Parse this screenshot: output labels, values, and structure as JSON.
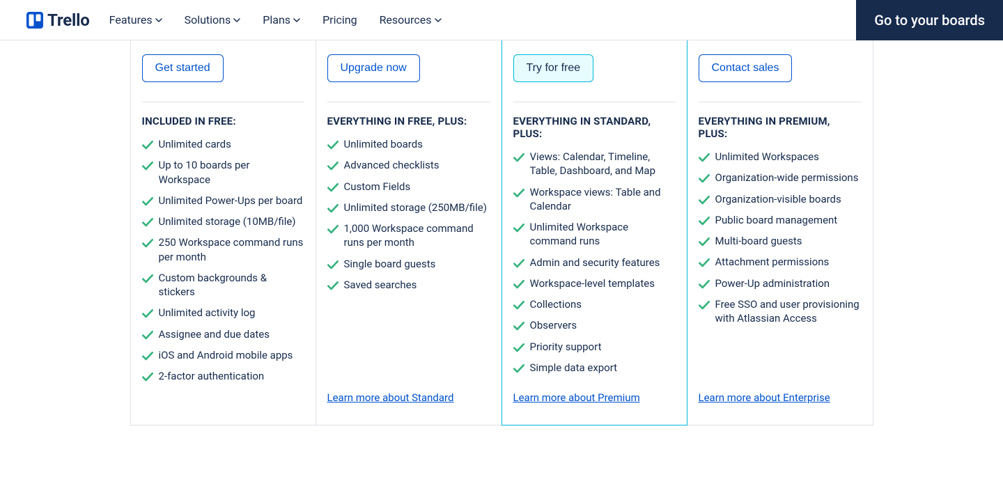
{
  "nav": {
    "brand": "Trello",
    "items": [
      "Features",
      "Solutions",
      "Plans",
      "Pricing",
      "Resources"
    ],
    "items_dropdown": [
      true,
      true,
      true,
      false,
      true
    ],
    "cta": "Go to your boards"
  },
  "columns": [
    {
      "id": "free",
      "cta": "Get started",
      "heading": "INCLUDED IN FREE:",
      "features": [
        "Unlimited cards",
        "Up to 10 boards per Workspace",
        "Unlimited Power-Ups per board",
        "Unlimited storage (10MB/file)",
        "250 Workspace command runs per month",
        "Custom backgrounds & stickers",
        "Unlimited activity log",
        "Assignee and due dates",
        "iOS and Android mobile apps",
        "2-factor authentication"
      ],
      "learn": ""
    },
    {
      "id": "standard",
      "cta": "Upgrade now",
      "heading": "EVERYTHING IN FREE, PLUS:",
      "features": [
        "Unlimited boards",
        "Advanced checklists",
        "Custom Fields",
        "Unlimited storage (250MB/file)",
        "1,000 Workspace command runs per month",
        "Single board guests",
        "Saved searches"
      ],
      "learn": "Learn more about Standard"
    },
    {
      "id": "premium",
      "cta": "Try for free",
      "heading": "EVERYTHING IN STANDARD, PLUS:",
      "features": [
        "Views: Calendar, Timeline, Table, Dashboard, and Map",
        "Workspace views: Table and Calendar",
        "Unlimited Workspace command runs",
        "Admin and security features",
        "Workspace-level templates",
        "Collections",
        "Observers",
        "Priority support",
        "Simple data export"
      ],
      "learn": "Learn more about Premium"
    },
    {
      "id": "enterprise",
      "cta": "Contact sales",
      "heading": "EVERYTHING IN PREMIUM, PLUS:",
      "features": [
        "Unlimited Workspaces",
        "Organization-wide permissions",
        "Organization-visible boards",
        "Public board management",
        "Multi-board guests",
        "Attachment permissions",
        "Power-Up administration",
        "Free SSO and user provisioning with Atlassian Access"
      ],
      "learn": "Learn more about Enterprise"
    }
  ]
}
